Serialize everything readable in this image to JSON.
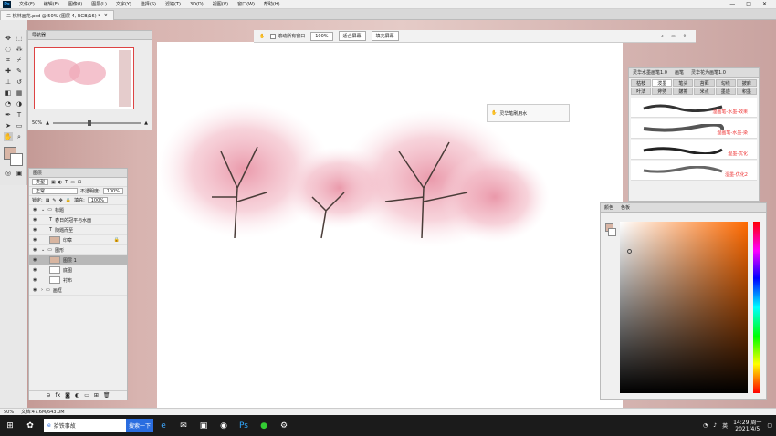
{
  "menubar": {
    "logo": "Ps",
    "items": [
      "文件(F)",
      "编辑(E)",
      "图像(I)",
      "图层(L)",
      "文字(Y)",
      "选择(S)",
      "滤镜(T)",
      "3D(D)",
      "视图(V)",
      "窗口(W)",
      "帮助(H)"
    ],
    "controls": [
      "—",
      "□",
      "✕"
    ]
  },
  "tab": {
    "title": "二·桃林画花.psd @ 50% (图层 4, RGB/16) *",
    "close": "×"
  },
  "optbar": {
    "scroll_all": "滚动所有窗口",
    "zoom_value": "100%",
    "fit_screen": "适合屏幕",
    "fill_screen": "填充屏幕"
  },
  "navigator": {
    "title": "导航器",
    "zoom": "50%"
  },
  "layers": {
    "title": "图层",
    "filter_kind": "类型",
    "blend_mode": "正常",
    "opacity_label": "不透明度:",
    "opacity_value": "100%",
    "lock_label": "锁定:",
    "fill_label": "填充:",
    "fill_value": "100%",
    "items": [
      {
        "name": "标题",
        "type": "group",
        "selected": false
      },
      {
        "name": "春日的冠平与水面",
        "type": "text",
        "selected": false
      },
      {
        "name": "随题而至",
        "type": "text",
        "selected": false
      },
      {
        "name": "印章",
        "type": "color",
        "selected": false
      },
      {
        "name": "图形",
        "type": "group",
        "selected": false
      },
      {
        "name": "图层 1",
        "type": "color",
        "selected": true
      },
      {
        "name": "底图",
        "type": "plain",
        "selected": false
      },
      {
        "name": "衬布",
        "type": "plain",
        "selected": false
      },
      {
        "name": "画框",
        "type": "group",
        "selected": false
      }
    ]
  },
  "brush_popup": {
    "label": "灵华笔刷用水"
  },
  "brushpanel": {
    "tabs": [
      "灵华水墨画笔1.0",
      "画笔",
      "灵华花为画笔1.0"
    ],
    "categories": [
      "枯枝",
      "泼墨",
      "笔头",
      "苔藓",
      "勾线",
      "披麻",
      "叶法",
      "斧劈",
      "皴擦",
      "米点",
      "墨迹",
      "积墨"
    ],
    "brushes": [
      {
        "label": "湿画笔-水墨-效果"
      },
      {
        "label": "湿画笔-水墨-染"
      },
      {
        "label": "湿墨-优化"
      },
      {
        "label": "湿墨-优化2"
      }
    ]
  },
  "colorpanel": {
    "tabs": [
      "颜色",
      "色板"
    ],
    "fg_color": "#d8b5a5",
    "bg_color": "#ffffff"
  },
  "statusbar": {
    "zoom": "50%",
    "doc_info": "文档:47.6M/643.0M"
  },
  "taskbar": {
    "search_text": "拾铁事故",
    "search_button": "搜索一下",
    "time": "14:29 周一",
    "date": "2021/4/5",
    "lang": "英"
  }
}
